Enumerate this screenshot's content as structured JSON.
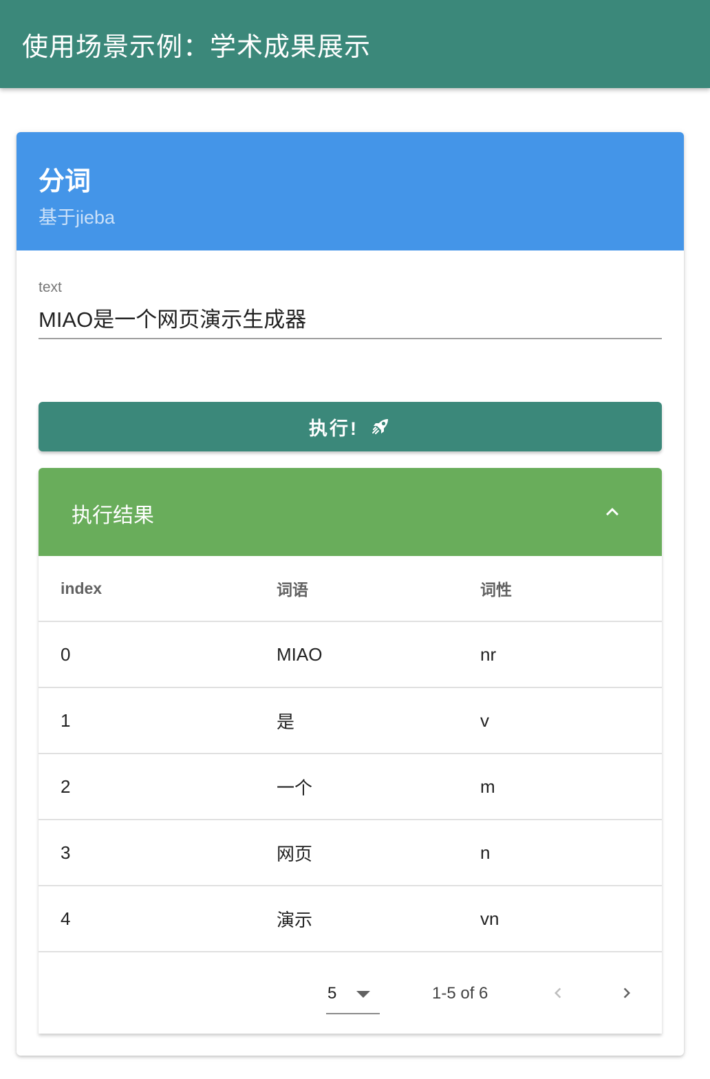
{
  "app_bar": {
    "title": "使用场景示例：学术成果展示"
  },
  "card": {
    "title": "分词",
    "subtitle": "基于jieba",
    "header_color": "#4495e8"
  },
  "text_field": {
    "label": "text",
    "value": "MIAO是一个网页演示生成器"
  },
  "run_button": {
    "label": "执行!",
    "icon": "rocket-icon",
    "color": "#3b887a"
  },
  "results_panel": {
    "title": "执行结果",
    "expanded": true,
    "icon": "chevron-up-icon",
    "header_color": "#69ad5b"
  },
  "table": {
    "headers": [
      "index",
      "词语",
      "词性"
    ],
    "rows": [
      [
        "0",
        "MIAO",
        "nr"
      ],
      [
        "1",
        "是",
        "v"
      ],
      [
        "2",
        "一个",
        "m"
      ],
      [
        "3",
        "网页",
        "n"
      ],
      [
        "4",
        "演示",
        "vn"
      ]
    ]
  },
  "pagination": {
    "rows_per_page": "5",
    "range": "1-5 of 6",
    "prev_enabled": false,
    "next_enabled": true
  }
}
